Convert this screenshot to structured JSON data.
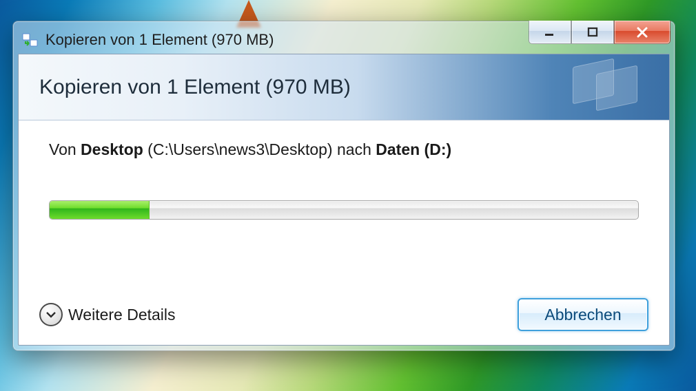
{
  "window": {
    "title": "Kopieren von 1 Element (970 MB)"
  },
  "header": {
    "title": "Kopieren von 1 Element (970 MB)"
  },
  "transfer": {
    "prefix": "Von ",
    "source_name": "Desktop",
    "source_path": " (C:\\Users\\news3\\Desktop) ",
    "middle": "nach ",
    "dest_name": "Daten (D:)"
  },
  "progress": {
    "percent": 17
  },
  "footer": {
    "details_label": "Weitere Details",
    "cancel_label": "Abbrechen"
  }
}
